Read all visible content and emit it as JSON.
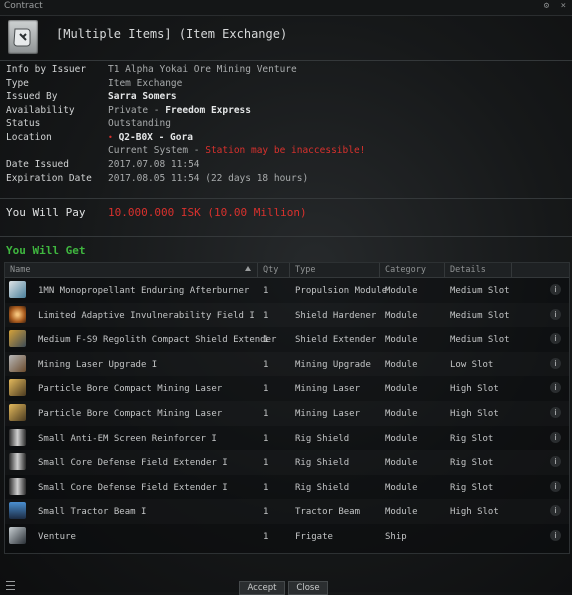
{
  "window": {
    "title": "Contract",
    "btn_settings": "⚙",
    "btn_close": "×"
  },
  "contract": {
    "name": "[Multiple Items] (Item Exchange)"
  },
  "info": {
    "issuer_label": "Info by Issuer",
    "issuer_value": "T1 Alpha Yokai Ore Mining Venture",
    "type_label": "Type",
    "type_value": "Item Exchange",
    "issued_by_label": "Issued By",
    "issued_by_value": "Sarra Somers",
    "availability_label": "Availability",
    "availability_prefix": "Private - ",
    "availability_corp": "Freedom Express",
    "status_label": "Status",
    "status_value": "Outstanding",
    "location_label": "Location",
    "location_value": "Q2-B0X - Gora",
    "current_system_prefix": "Current System - ",
    "current_system_warning": "Station may be inaccessible!",
    "date_issued_label": "Date Issued",
    "date_issued_value": "2017.07.08 11:54",
    "expiration_label": "Expiration Date",
    "expiration_value": "2017.08.05 11:54 (22 days 18 hours)"
  },
  "pay": {
    "label": "You Will Pay",
    "value": "10.000.000 ISK (10.00 Million)"
  },
  "get": {
    "label": "You Will Get"
  },
  "table": {
    "headers": {
      "name": "Name",
      "qty": "Qty",
      "type": "Type",
      "category": "Category",
      "details": "Details"
    },
    "rows": [
      {
        "icon": "afterburner-icon",
        "name": "1MN Monopropellant Enduring Afterburner",
        "qty": "1",
        "type": "Propulsion Module",
        "category": "Module",
        "details": "Medium Slot"
      },
      {
        "icon": "shield-hardener-icon",
        "name": "Limited Adaptive Invulnerability Field I",
        "qty": "1",
        "type": "Shield Hardener",
        "category": "Module",
        "details": "Medium Slot"
      },
      {
        "icon": "shield-extender-icon",
        "name": "Medium F-S9 Regolith Compact Shield Extender",
        "qty": "1",
        "type": "Shield Extender",
        "category": "Module",
        "details": "Medium Slot"
      },
      {
        "icon": "mining-upgrade-icon",
        "name": "Mining Laser Upgrade I",
        "qty": "1",
        "type": "Mining Upgrade",
        "category": "Module",
        "details": "Low Slot"
      },
      {
        "icon": "mining-laser-icon",
        "name": "Particle Bore Compact Mining Laser",
        "qty": "1",
        "type": "Mining Laser",
        "category": "Module",
        "details": "High Slot"
      },
      {
        "icon": "mining-laser-icon",
        "name": "Particle Bore Compact Mining Laser",
        "qty": "1",
        "type": "Mining Laser",
        "category": "Module",
        "details": "High Slot"
      },
      {
        "icon": "rig-icon",
        "name": "Small Anti-EM Screen Reinforcer I",
        "qty": "1",
        "type": "Rig Shield",
        "category": "Module",
        "details": "Rig Slot"
      },
      {
        "icon": "rig-icon",
        "name": "Small Core Defense Field Extender I",
        "qty": "1",
        "type": "Rig Shield",
        "category": "Module",
        "details": "Rig Slot"
      },
      {
        "icon": "rig-icon",
        "name": "Small Core Defense Field Extender I",
        "qty": "1",
        "type": "Rig Shield",
        "category": "Module",
        "details": "Rig Slot"
      },
      {
        "icon": "tractor-beam-icon",
        "name": "Small Tractor Beam I",
        "qty": "1",
        "type": "Tractor Beam",
        "category": "Module",
        "details": "High Slot"
      },
      {
        "icon": "frigate-ship-icon",
        "name": "Venture",
        "qty": "1",
        "type": "Frigate",
        "category": "Ship",
        "details": ""
      }
    ],
    "info_glyph": "i"
  },
  "footer": {
    "accept_label": "Accept",
    "close_label": "Close"
  },
  "colors": {
    "red": "#d8312d",
    "green": "#3fb63f"
  }
}
